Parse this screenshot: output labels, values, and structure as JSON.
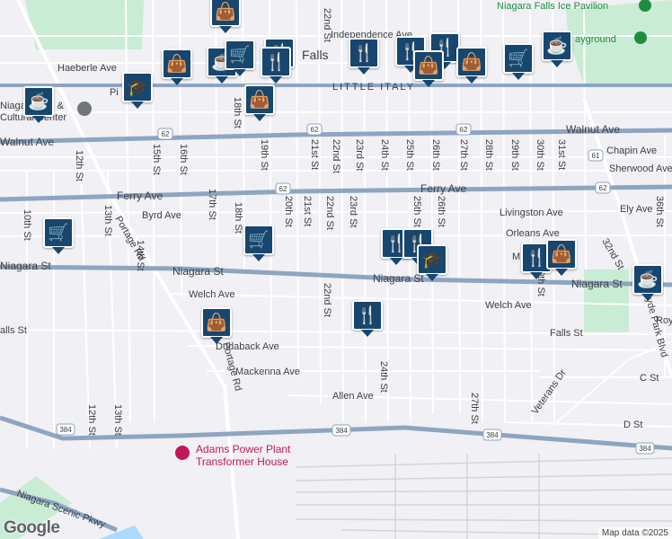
{
  "map": {
    "colors": {
      "land": "#f1f0f4",
      "park": "#c9ecd5",
      "road": "#ffffff",
      "highway": "#8ea5c2",
      "rail": "#d4d4d8",
      "pin": "#17466e",
      "poi_text": "#c2185b",
      "water": "#aadaff"
    },
    "places": {
      "ice_pavilion": "Niagara Falls Ice Pavilion",
      "playground": "ayground",
      "little_italy": "LITTLE ITALY",
      "falls_partial": "Falls",
      "arts_center_line1": "Niagara Arts &",
      "arts_center_line2": "Cultural Center",
      "power_plant_line1": "Adams Power Plant",
      "power_plant_line2": "Transformer House"
    },
    "roads": {
      "walnut_ave": "Walnut Ave",
      "ferry_ave": "Ferry Ave",
      "ferry_ave_center": "Ferry Ave",
      "niagara_st_left": "Niagara St",
      "niagara_st_mid": "Niagara St",
      "niagara_st_center": "Niagara St",
      "niagara_st_right": "Niagara St",
      "independence_ave": "Independence Ave",
      "haeberle_ave": "Haeberle Ave",
      "pine_ave": "Pi",
      "byrd_ave": "Byrd Ave",
      "welch_ave_left": "Welch Ave",
      "welch_ave_right": "Welch Ave",
      "falls_st_left": "alls St",
      "falls_st_right": "Falls St",
      "duaback_ave": "Dudaback Ave",
      "mackenna_ave": "Mackenna Ave",
      "allen_ave": "Allen Ave",
      "chapin_ave": "Chapin Ave",
      "sherwood_ave": "Sherwood Ave",
      "livingston_ave": "Livingston Ave",
      "ely_ave": "Ely Ave",
      "orleans_ave": "Orleans Ave",
      "portage_rd_upper": "Portage Rd",
      "portage_rd_lower": "Portage Rd",
      "hyde_park_blvd": "Hyde Park Blvd",
      "veterans_dr": "Veterans Dr",
      "c_st": "C St",
      "d_st": "D St",
      "royal": "Roy",
      "scenic_pkwy": "Niagara Scenic Pkwy",
      "st_22_top": "22nd St",
      "st_21_upper": "21st St",
      "st_22_upper": "22nd St",
      "st_23_upper": "23rd St",
      "st_24_upper": "24th St",
      "st_25_upper": "25th St",
      "st_26_upper": "26th St",
      "st_27_upper": "27th St",
      "st_28_upper": "28th St",
      "st_29_upper": "29th St",
      "st_30_upper": "30th St",
      "st_31_upper": "31st St",
      "st_15": "15th St",
      "st_16": "16th St",
      "st_18_upper": "18th St",
      "st_19": "19th St",
      "st_12_upper": "12th St",
      "st_10": "10th St",
      "st_13_upper": "13th St",
      "st_14": "14th St",
      "st_17": "17th St",
      "st_18_lower": "18th St",
      "st_20": "20th St",
      "st_21_lower": "21st St",
      "st_22_lower": "22nd St",
      "st_23_lower": "23rd St",
      "st_25_lower": "25th St",
      "st_26_lower": "26th St",
      "st_22_south": "22nd St",
      "st_24_south": "24th St",
      "st_27_south": "27th St",
      "st_30_lower": "30th St",
      "st_32": "32nd St",
      "st_36": "36th St",
      "st_12_lower": "12th St",
      "st_13_lower": "13th St",
      "m_partial": "M"
    },
    "shields": [
      "62",
      "62",
      "62",
      "62",
      "62",
      "61",
      "384",
      "384",
      "384",
      "384"
    ],
    "attribution": "Map data ©2025",
    "logo": "Google"
  },
  "markers": [
    {
      "type": "shopping-bag",
      "glyph": "👜"
    },
    {
      "type": "shopping-bag",
      "glyph": "👜"
    },
    {
      "type": "coffee",
      "glyph": "☕"
    },
    {
      "type": "shopping-cart",
      "glyph": "🛒"
    },
    {
      "type": "restaurant",
      "glyph": "🍴"
    },
    {
      "type": "restaurant",
      "glyph": "🍴"
    },
    {
      "type": "school",
      "glyph": "🎓"
    },
    {
      "type": "coffee",
      "glyph": "☕"
    },
    {
      "type": "shopping-bag",
      "glyph": "👜"
    },
    {
      "type": "restaurant",
      "glyph": "🍴"
    },
    {
      "type": "restaurant",
      "glyph": "🍴"
    },
    {
      "type": "restaurant",
      "glyph": "🍴"
    },
    {
      "type": "shopping-bag",
      "glyph": "👜"
    },
    {
      "type": "shopping-bag",
      "glyph": "👜"
    },
    {
      "type": "shopping-cart",
      "glyph": "🛒"
    },
    {
      "type": "coffee",
      "glyph": "☕"
    },
    {
      "type": "shopping-cart",
      "glyph": "🛒"
    },
    {
      "type": "shopping-cart",
      "glyph": "🛒"
    },
    {
      "type": "restaurant",
      "glyph": "🍴"
    },
    {
      "type": "restaurant",
      "glyph": "🍴"
    },
    {
      "type": "school",
      "glyph": "🎓"
    },
    {
      "type": "restaurant",
      "glyph": "🍴"
    },
    {
      "type": "shopping-bag",
      "glyph": "👜"
    },
    {
      "type": "restaurant",
      "glyph": "🍴"
    },
    {
      "type": "shopping-bag",
      "glyph": "👜"
    },
    {
      "type": "coffee",
      "glyph": "☕"
    }
  ]
}
